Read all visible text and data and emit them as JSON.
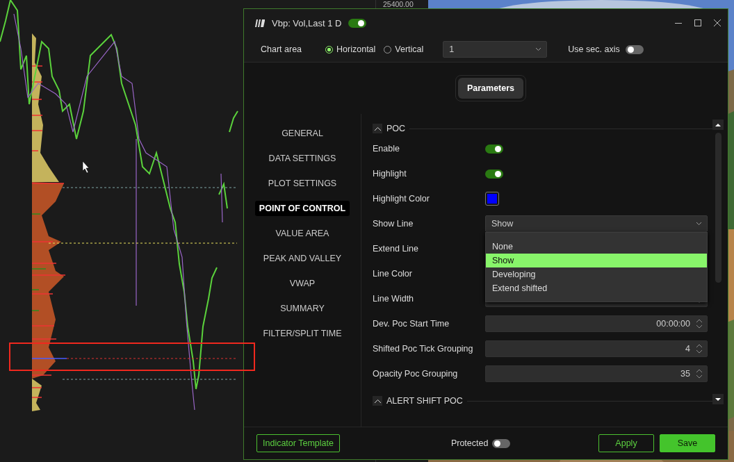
{
  "background_chart": {
    "price_label": "25400.00"
  },
  "dialog": {
    "title": "Vbp: Vol,Last 1 D",
    "enabled": true,
    "chart_area": {
      "label": "Chart area",
      "options": [
        {
          "label": "Horizontal",
          "selected": true
        },
        {
          "label": "Vertical",
          "selected": false
        }
      ]
    },
    "panel_select": {
      "value": "1"
    },
    "sec_axis": {
      "label": "Use sec. axis",
      "on": false
    },
    "tabs": [
      {
        "label": "Parameters",
        "selected": true
      }
    ],
    "nav": [
      {
        "label": "GENERAL",
        "selected": false
      },
      {
        "label": "DATA SETTINGS",
        "selected": false
      },
      {
        "label": "PLOT SETTINGS",
        "selected": false
      },
      {
        "label": "POINT OF CONTROL",
        "selected": true
      },
      {
        "label": "VALUE AREA",
        "selected": false
      },
      {
        "label": "PEAK AND VALLEY",
        "selected": false
      },
      {
        "label": "VWAP",
        "selected": false
      },
      {
        "label": "SUMMARY",
        "selected": false
      },
      {
        "label": "FILTER/SPLIT TIME",
        "selected": false
      }
    ],
    "sections": [
      {
        "title": "POC",
        "expanded": true,
        "rows": [
          {
            "kind": "toggle",
            "label": "Enable",
            "on": true
          },
          {
            "kind": "toggle",
            "label": "Highlight",
            "on": true
          },
          {
            "kind": "color",
            "label": "Highlight Color",
            "color": "#0000ff"
          },
          {
            "kind": "select",
            "label": "Show Line",
            "value": "Show",
            "open": true,
            "options": [
              {
                "label": "None",
                "selected": false
              },
              {
                "label": "Show",
                "selected": true
              },
              {
                "label": "Developing",
                "selected": false
              },
              {
                "label": "Extend shifted",
                "selected": false
              }
            ]
          },
          {
            "kind": "covered",
            "label": "Extend Line"
          },
          {
            "kind": "covered",
            "label": "Line Color"
          },
          {
            "kind": "number",
            "label": "Line Width"
          },
          {
            "kind": "number",
            "label": "Dev. Poc Start Time",
            "value": "00:00:00"
          },
          {
            "kind": "number",
            "label": "Shifted Poc Tick Grouping",
            "value": "4"
          },
          {
            "kind": "number",
            "label": "Opacity Poc Grouping",
            "value": "35"
          }
        ]
      },
      {
        "title": "ALERT SHIFT POC",
        "expanded": true
      }
    ],
    "footer": {
      "template_button": "Indicator Template",
      "protected": {
        "label": "Protected",
        "on": false
      },
      "buttons": [
        {
          "label": "Apply",
          "kind": "outline"
        },
        {
          "label": "Save",
          "kind": "primary"
        }
      ]
    }
  }
}
